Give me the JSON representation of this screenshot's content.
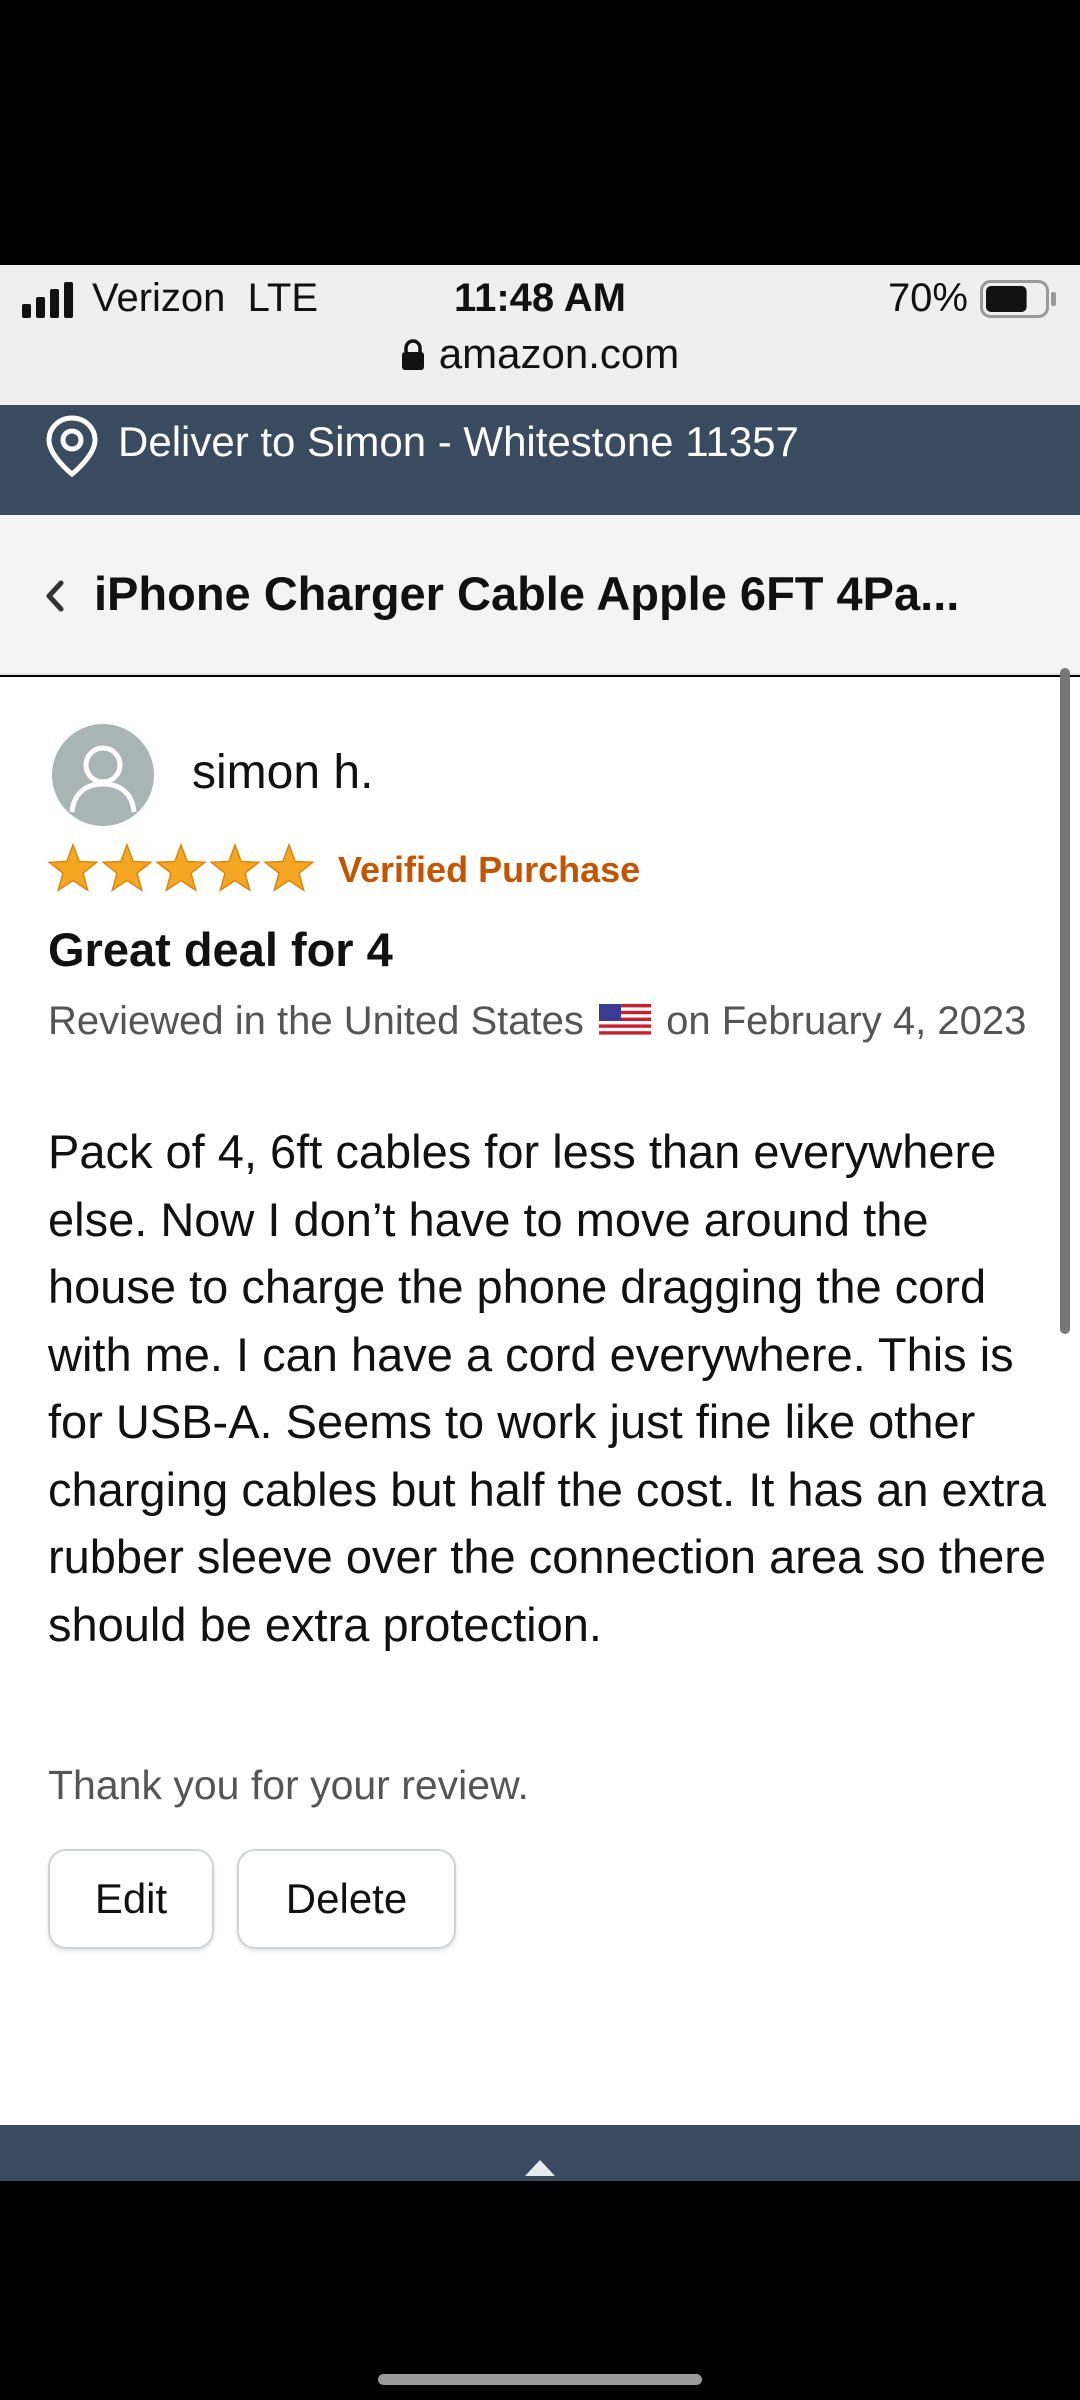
{
  "status_bar": {
    "carrier": "Verizon",
    "network": "LTE",
    "time": "11:48 AM",
    "battery_percent": "70%",
    "battery_level": 0.7,
    "url": "amazon.com"
  },
  "deliver_bar": {
    "text": "Deliver to Simon - Whitestone 11357",
    "icon": "location-pin-icon"
  },
  "header": {
    "title": "iPhone Charger Cable Apple 6FT 4Pa...",
    "back_icon": "chevron-left-icon"
  },
  "review": {
    "reviewer_name": "simon h.",
    "rating": 5,
    "rating_max": 5,
    "verified_label": "Verified Purchase",
    "title": "Great deal for 4",
    "meta_prefix": "Reviewed in the United States",
    "meta_suffix": "on February 4, 2023",
    "body": "Pack of 4, 6ft cables for less than everywhere else. Now I don’t have to move around the house to charge the phone dragging the cord with me. I can have a cord everywhere. This is for USB-A. Seems to work just fine like other charging cables but half the cost. It has an extra rubber sleeve over the connection area so there should be extra protection."
  },
  "footer": {
    "thanks": "Thank you for your review.",
    "edit_label": "Edit",
    "delete_label": "Delete"
  },
  "colors": {
    "nav_bar": "#3a4a5f",
    "star": "#f5a623",
    "verified": "#c45500"
  }
}
